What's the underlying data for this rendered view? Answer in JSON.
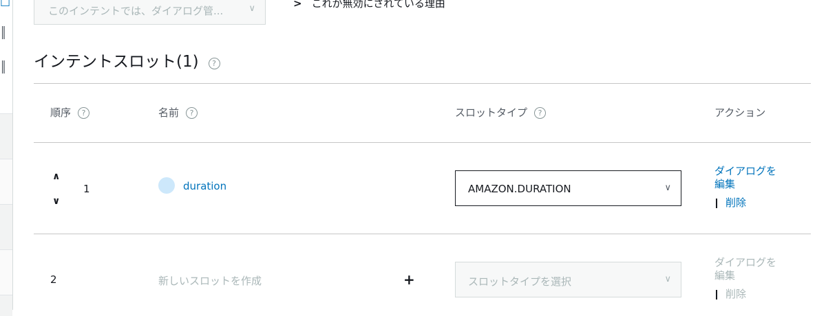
{
  "dialog_select": {
    "placeholder": "このインテントでは、ダイアログ管...",
    "chevron_icon": "chevron-down"
  },
  "why_disabled_link": "これが無効にされている理由",
  "section": {
    "title": "インテントスロット(1)",
    "help_icon": "?"
  },
  "table": {
    "headers": {
      "order": "順序",
      "name": "名前",
      "slot_type": "スロットタイプ",
      "action": "アクション"
    },
    "help_icon": "?",
    "rows": [
      {
        "order": "1",
        "name": "duration",
        "slot_type": "AMAZON.DURATION",
        "edit_dialog_line1": "ダイアログを",
        "edit_dialog_line2": "編集",
        "delete": "削除"
      }
    ],
    "new_row": {
      "order": "2",
      "name_placeholder": "新しいスロットを作成",
      "add_icon": "+",
      "slot_type_placeholder": "スロットタイプを選択",
      "edit_dialog_line1": "ダイアログを",
      "edit_dialog_line2": "編集",
      "delete": "削除"
    }
  },
  "colors": {
    "link": "#0073bb",
    "disabled_text": "#aab7b8",
    "slot_dot": "#cde8fb",
    "border": "#c6c6c6"
  }
}
